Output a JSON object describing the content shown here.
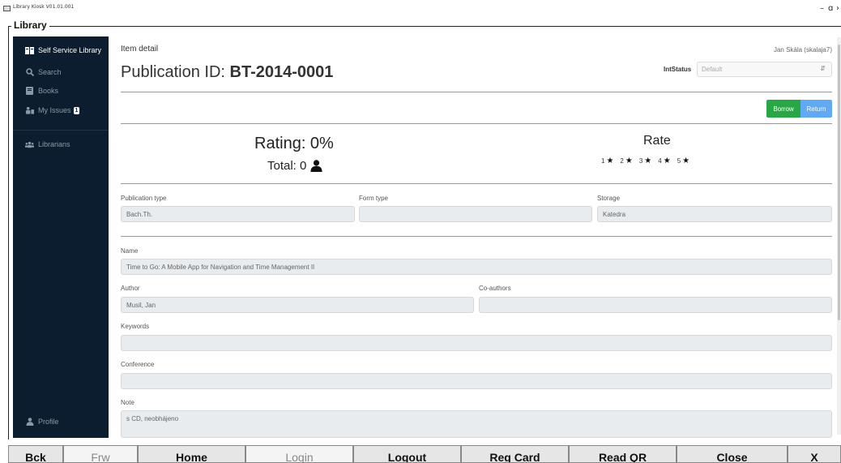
{
  "window": {
    "title": "Library Kiosk V01.01.001",
    "minimize": "–",
    "maximize": "ɑ",
    "close": "›"
  },
  "group_label": "Library",
  "sidebar": {
    "items": [
      {
        "label": "Self Service Library",
        "icon": "book-open-icon"
      },
      {
        "label": "Search",
        "icon": "search-icon"
      },
      {
        "label": "Books",
        "icon": "book-icon"
      },
      {
        "label": "My Issues",
        "icon": "person-box-icon",
        "badge": "1"
      },
      {
        "label": "Librarians",
        "icon": "users-icon"
      },
      {
        "label": "Profile",
        "icon": "user-icon"
      }
    ]
  },
  "header": {
    "breadcrumb": "Item detail",
    "user": "Jan Skála (skalaja7)",
    "title_prefix": "Publication ID: ",
    "title_id": "BT-2014-0001",
    "intstatus_label": "IntStatus",
    "intstatus_value": "Default"
  },
  "actions": {
    "borrow": "Borrow",
    "return": "Return"
  },
  "rating": {
    "rating_text": "Rating: 0%",
    "total_text": "Total: 0",
    "rate_title": "Rate",
    "stars": [
      "1",
      "2",
      "3",
      "4",
      "5"
    ]
  },
  "fields": {
    "publication_type": {
      "label": "Publication type",
      "value": "Bach.Th."
    },
    "form_type": {
      "label": "Form type",
      "value": ""
    },
    "storage": {
      "label": "Storage",
      "value": "Katedra"
    },
    "name": {
      "label": "Name",
      "value": "Time to Go: A Mobile App for Navigation and Time Management II"
    },
    "author": {
      "label": "Author",
      "value": "Musil, Jan"
    },
    "coauthors": {
      "label": "Co-authors",
      "value": ""
    },
    "keywords": {
      "label": "Keywords",
      "value": ""
    },
    "conference": {
      "label": "Conference",
      "value": ""
    },
    "note": {
      "label": "Note",
      "value": "s CD, neobhájeno"
    }
  },
  "bottom_buttons": [
    {
      "label": "Bck",
      "enabled": true
    },
    {
      "label": "Frw",
      "enabled": false
    },
    {
      "label": "Home",
      "enabled": true
    },
    {
      "label": "Login",
      "enabled": false
    },
    {
      "label": "Logout",
      "enabled": true
    },
    {
      "label": "Reg Card",
      "enabled": true
    },
    {
      "label": "Read QR",
      "enabled": true
    },
    {
      "label": "Close",
      "enabled": true
    },
    {
      "label": "X",
      "enabled": true
    }
  ],
  "colors": {
    "sidebar_bg": "#0b1d2e",
    "borrow": "#28a745",
    "return": "#5fa9f5"
  }
}
